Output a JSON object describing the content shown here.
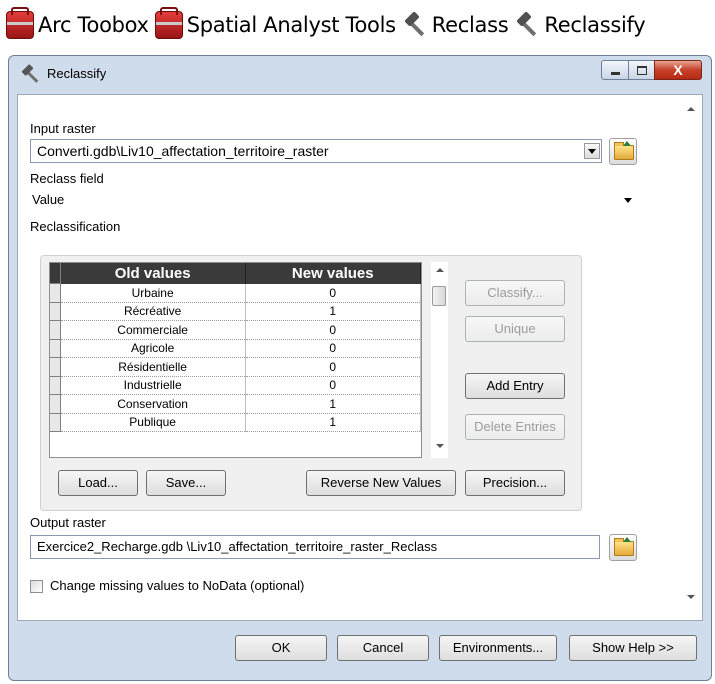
{
  "breadcrumb": {
    "items": [
      {
        "label": "Arc Toobox",
        "icon": "toolbox-icon"
      },
      {
        "label": "Spatial Analyst Tools",
        "icon": "toolbox-icon"
      },
      {
        "label": "Reclass",
        "icon": "toolset-icon"
      },
      {
        "label": "Reclassify",
        "icon": "hammer-tool-icon"
      }
    ]
  },
  "window": {
    "title": "Reclassify",
    "close_glyph": "X"
  },
  "form": {
    "input_raster_label": "Input raster",
    "input_raster_value": "Converti.gdb\\Liv10_affectation_territoire_raster",
    "reclass_field_label": "Reclass field",
    "reclass_field_value": "Value",
    "reclassification_label": "Reclassification",
    "output_raster_label": "Output raster",
    "output_raster_value": "Exercice2_Recharge.gdb \\Liv10_affectation_territoire_raster_Reclass",
    "missing_values_label": "Change missing values to NoData (optional)",
    "missing_values_checked": false
  },
  "reclass_table": {
    "headers": [
      "Old values",
      "New values"
    ],
    "rows": [
      {
        "old": "Urbaine",
        "new": "0"
      },
      {
        "old": "Récréative",
        "new": "1"
      },
      {
        "old": "Commerciale",
        "new": "0"
      },
      {
        "old": "Agricole",
        "new": "0"
      },
      {
        "old": "Résidentielle",
        "new": "0"
      },
      {
        "old": "Industrielle",
        "new": "0"
      },
      {
        "old": "Conservation",
        "new": "1"
      },
      {
        "old": "Publique",
        "new": "1"
      }
    ]
  },
  "reclass_buttons": {
    "classify": "Classify...",
    "unique": "Unique",
    "add_entry": "Add Entry",
    "delete_entries": "Delete Entries",
    "load": "Load...",
    "save": "Save...",
    "reverse": "Reverse New Values",
    "precision": "Precision..."
  },
  "footer": {
    "ok": "OK",
    "cancel": "Cancel",
    "environments": "Environments...",
    "show_help": "Show Help >>"
  }
}
